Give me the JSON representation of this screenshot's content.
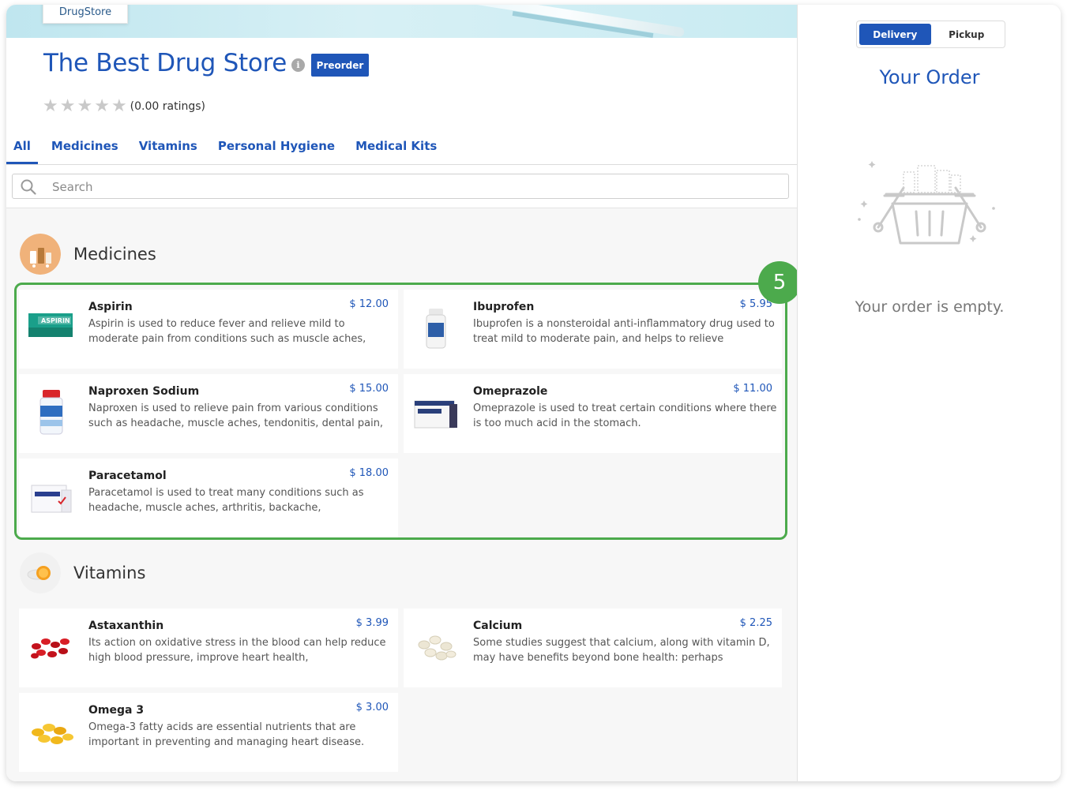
{
  "store": {
    "logo": "DrugStore",
    "title": "The Best Drug Store",
    "preorder_label": "Preorder",
    "ratings": "(0.00 ratings)",
    "stars_filled": 0,
    "stars_total": 5
  },
  "tabs": [
    {
      "label": "All",
      "active": true
    },
    {
      "label": "Medicines"
    },
    {
      "label": "Vitamins"
    },
    {
      "label": "Personal Hygiene"
    },
    {
      "label": "Medical Kits"
    }
  ],
  "search": {
    "placeholder": "Search"
  },
  "sections": {
    "medicines": {
      "title": "Medicines",
      "items": [
        {
          "name": "Aspirin",
          "price": "$ 12.00",
          "description": "Aspirin is used to reduce fever and relieve mild to moderate pain from conditions such as muscle aches,"
        },
        {
          "name": "Ibuprofen",
          "price": "$ 5.95",
          "description": "Ibuprofen is a nonsteroidal anti-inflammatory drug used to treat mild to moderate pain, and helps to relieve"
        },
        {
          "name": "Naproxen Sodium",
          "price": "$ 15.00",
          "description": "Naproxen is used to relieve pain from various conditions such as headache, muscle aches, tendonitis, dental pain,"
        },
        {
          "name": "Omeprazole",
          "price": "$ 11.00",
          "description": "Omeprazole is used to treat certain conditions where there is too much acid in the stomach."
        },
        {
          "name": "Paracetamol",
          "price": "$ 18.00",
          "description": "Paracetamol is used to treat many conditions such as headache, muscle aches, arthritis, backache,"
        }
      ]
    },
    "vitamins": {
      "title": "Vitamins",
      "items": [
        {
          "name": "Astaxanthin",
          "price": "$ 3.99",
          "description": "Its action on oxidative stress in the blood can help reduce high blood pressure, improve heart health,"
        },
        {
          "name": "Calcium",
          "price": "$ 2.25",
          "description": "Some studies suggest that calcium, along with vitamin D, may have benefits beyond bone health: perhaps"
        },
        {
          "name": "Omega 3",
          "price": "$ 3.00",
          "description": "Omega-3 fatty acids are essential nutrients that are important in preventing and managing heart disease."
        }
      ]
    }
  },
  "annotation": {
    "badge": "5",
    "color": "#4caa4c"
  },
  "order": {
    "modes": [
      "Delivery",
      "Pickup"
    ],
    "active_mode": "Delivery",
    "title": "Your Order",
    "empty_text": "Your order is empty."
  },
  "colors": {
    "accent": "#1f56b8",
    "highlight": "#4caa4c"
  }
}
